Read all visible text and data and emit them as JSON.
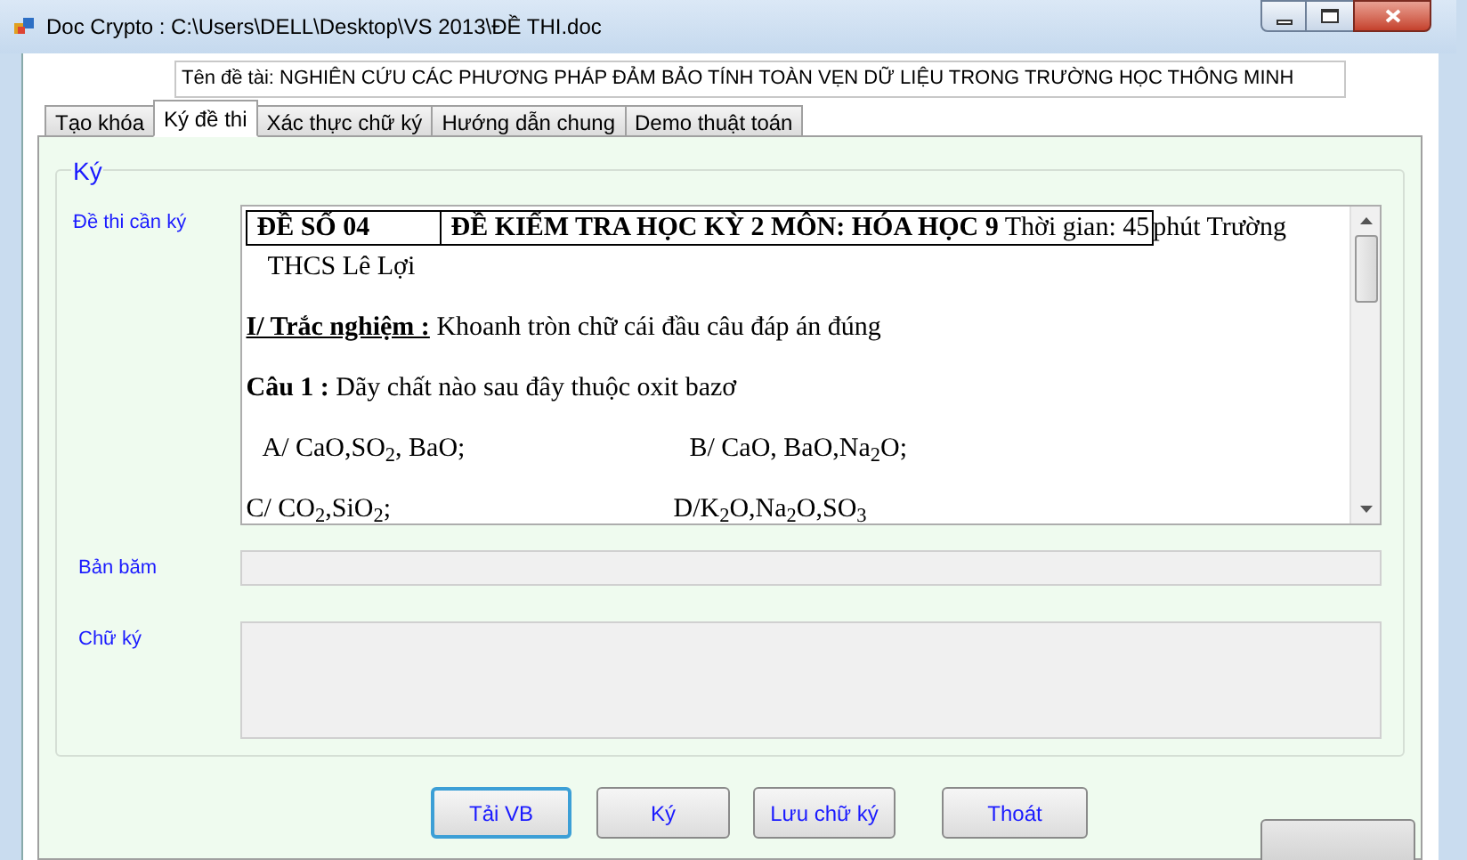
{
  "window": {
    "title": "Doc Crypto : C:\\Users\\DELL\\Desktop\\VS 2013\\ĐỀ THI.doc"
  },
  "topic": "Tên đề tài: NGHIÊN CỨU CÁC PHƯƠNG PHÁP ĐẢM BẢO TÍNH TOÀN VẸN DỮ LIỆU TRONG TRƯỜNG HỌC THÔNG MINH",
  "tabs": [
    {
      "label": "Tạo khóa",
      "selected": false
    },
    {
      "label": "Ký đề thi",
      "selected": true
    },
    {
      "label": "Xác thực chữ ký",
      "selected": false
    },
    {
      "label": "Hướng dẫn chung",
      "selected": false
    },
    {
      "label": "Demo thuật toán",
      "selected": false
    }
  ],
  "group": {
    "title": "Ký",
    "document_label": "Đề thi cần ký",
    "document": {
      "header_cells": [
        "ĐỀ SỐ 04",
        "**ĐỀ KIỂM TRA HỌC KỲ 2 MÔN: HÓA HỌC 9** Thời gian: 45"
      ],
      "header_rest": "phút Trường",
      "header_wrap": "THCS Lê Lợi",
      "lines": [
        {
          "kind": "lead",
          "lead": "I/ Trắc nghiệm :",
          "underline": true,
          "text": "Khoanh tròn chữ cái đầu câu đáp án đúng"
        },
        {
          "kind": "lead",
          "lead": "Câu 1 :",
          "underline": false,
          "text": "Dãy chất nào sau đây thuộc oxit bazơ"
        },
        {
          "kind": "options",
          "indent": true,
          "items": [
            "A/ CaO,SO$_{2}$, BaO;",
            "B/ CaO, BaO,Na$_{2}$O;"
          ]
        },
        {
          "kind": "options",
          "indent": false,
          "items": [
            "C/ CO$_{2}$,SiO$_{2}$;",
            "D/K$_{2}$O,Na$_{2}$O,SO$_{3}$"
          ]
        }
      ]
    },
    "hash_label": "Bản băm",
    "signature_label": "Chữ ký"
  },
  "buttons": [
    {
      "label": "Tải VB",
      "focused": true
    },
    {
      "label": "Ký",
      "focused": false
    },
    {
      "label": "Lưu chữ ký",
      "focused": false
    },
    {
      "label": "Thoát",
      "focused": false
    }
  ]
}
